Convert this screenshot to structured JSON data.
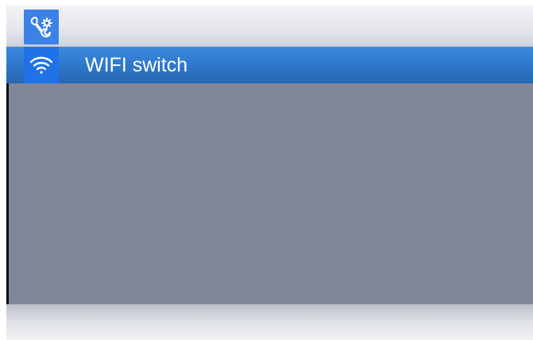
{
  "header": {
    "icon": "wrench-gear-icon"
  },
  "menu": {
    "items": [
      {
        "label": "WIFI switch",
        "icon": "wifi-icon",
        "selected": true
      }
    ]
  },
  "colors": {
    "selection": "#2e76c9",
    "icon_tile": "#1f72e8",
    "content_background": "#80879a",
    "bar_light": "#e6e8ed"
  }
}
